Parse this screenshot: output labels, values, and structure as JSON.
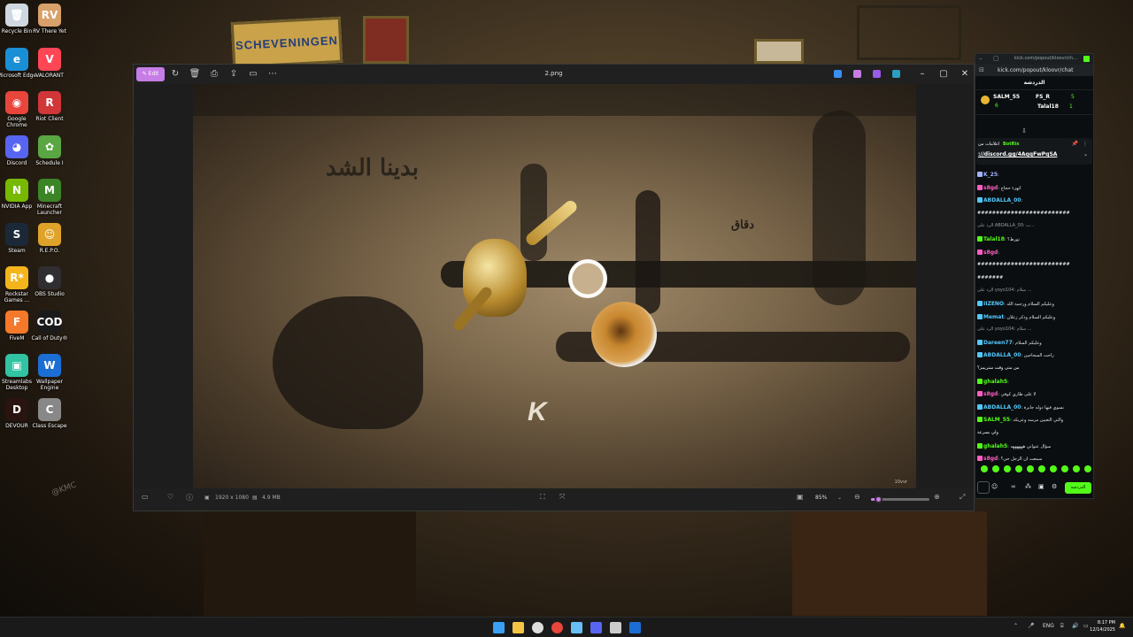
{
  "desktop": {
    "wallpaper_poster": "SCHEVENINGEN",
    "watermark": "@KMC",
    "icons": [
      {
        "label": "Recycle Bin",
        "glyph": "🗑",
        "color": "#cfd8e0"
      },
      {
        "label": "RV There Yet",
        "glyph": "RV",
        "color": "#d8a06a"
      },
      {
        "label": "Microsoft Edge",
        "glyph": "e",
        "color": "#1a8fd6"
      },
      {
        "label": "VALORANT",
        "glyph": "V",
        "color": "#ff4655"
      },
      {
        "label": "Google Chrome",
        "glyph": "◉",
        "color": "#e8453c"
      },
      {
        "label": "Riot Client",
        "glyph": "R",
        "color": "#d13639"
      },
      {
        "label": "Discord",
        "glyph": "◕",
        "color": "#5865f2"
      },
      {
        "label": "Schedule I",
        "glyph": "✿",
        "color": "#5aa642"
      },
      {
        "label": "NVIDIA App",
        "glyph": "N",
        "color": "#76b900"
      },
      {
        "label": "Minecraft Launcher",
        "glyph": "M",
        "color": "#3c8527"
      },
      {
        "label": "Steam",
        "glyph": "S",
        "color": "#1b2838"
      },
      {
        "label": "R.E.P.O.",
        "glyph": "☺",
        "color": "#e0a32a"
      },
      {
        "label": "Rockstar Games ...",
        "glyph": "R*",
        "color": "#f3b51b"
      },
      {
        "label": "OBS Studio",
        "glyph": "●",
        "color": "#302e31"
      },
      {
        "label": "FiveM",
        "glyph": "F",
        "color": "#f5792a"
      },
      {
        "label": "Call of Duty®",
        "glyph": "COD",
        "color": "#1a1a1a"
      },
      {
        "label": "Streamlabs Desktop",
        "glyph": "▣",
        "color": "#31c3a2"
      },
      {
        "label": "Wallpaper Engine",
        "glyph": "W",
        "color": "#1c6ed4"
      },
      {
        "label": "DEVOUR",
        "glyph": "D",
        "color": "#2a1410"
      },
      {
        "label": "Class Escape",
        "glyph": "C",
        "color": "#888888"
      }
    ]
  },
  "viewer": {
    "edit_label": "Edit",
    "file_name": "2.png",
    "resolution": "1920 x 1080",
    "file_size": "4.9 MB",
    "zoom_percent": "85%",
    "zoom_level": 0.12,
    "accent": "#c77de6",
    "image": {
      "title_text": "بدينا الشد",
      "subtitle_text": "دقاق",
      "logo_text": "K",
      "signature": "10vvr"
    }
  },
  "chat": {
    "url": "kick.com/popout/kloovr/ch...",
    "address": "kick.com/popout/kloovr/chat",
    "header": "الدردشة",
    "gifters": [
      {
        "name": "SALM_55",
        "count": "6"
      },
      {
        "name": "FS_R",
        "count": "5"
      },
      {
        "name": "Talal18",
        "count": "1"
      }
    ],
    "pinned": {
      "prefix": "اعلامات من",
      "user": "BotRix",
      "link": "://discord.gg/4AqqFwPqSA"
    },
    "messages": [
      {
        "user": "K_25",
        "color": "#9fb3ff",
        "text": ""
      },
      {
        "user": "s8gd",
        "color": "#ff5ec4",
        "text": "اتهزء حجاج"
      },
      {
        "user": "ABDALLA_00",
        "color": "#53c8fc",
        "text": ""
      },
      {
        "user": "",
        "color": "#ffffff",
        "text": "#########################"
      },
      {
        "user": "",
        "color": "#9a9a9a",
        "text": "الرد على ABDALLA_00: ب..."
      },
      {
        "user": "Talal18",
        "color": "#53fc18",
        "text": "تورط؟"
      },
      {
        "user": "s8gd",
        "color": "#ff5ec4",
        "text": ""
      },
      {
        "user": "",
        "color": "#ffffff",
        "text": "#########################"
      },
      {
        "user": "",
        "color": "#ffffff",
        "text": "#######"
      },
      {
        "user": "",
        "color": "#9a9a9a",
        "text": "الرد على yoyo104: سلام ..."
      },
      {
        "user": "IIZENO",
        "color": "#53c8fc",
        "text": "وعليكم السلام ورحمة الله"
      },
      {
        "user": "Memat",
        "color": "#53c8fc",
        "text": "وعليكم السلام وذكر زعلان"
      },
      {
        "user": "",
        "color": "#9a9a9a",
        "text": "الرد على yoyo104: سلام ..."
      },
      {
        "user": "Dareen77",
        "color": "#53c8fc",
        "text": "وعليكم السلام"
      },
      {
        "user": "ABDALLA_00",
        "color": "#53c8fc",
        "text": "راحت السحاجين"
      },
      {
        "user": "",
        "color": "#ffffff",
        "text": "من متى وقت ستريمز؟"
      },
      {
        "user": "ghalah5",
        "color": "#53fc18",
        "text": ""
      },
      {
        "user": "s8gd",
        "color": "#ff5ec4",
        "text": "لا على طاري كوفي"
      },
      {
        "user": "ABDALLA_00",
        "color": "#53c8fc",
        "text": "نسوي فيها دوله جابرة"
      },
      {
        "user": "SALM_55",
        "color": "#53fc18",
        "text": "والتي التعيين مرسه وعريكه"
      },
      {
        "user": "",
        "color": "#ffffff",
        "text": "ولي بسرعة"
      },
      {
        "user": "ghalah5",
        "color": "#53fc18",
        "text": "سؤال عنواني ههههههه"
      },
      {
        "user": "s8gd",
        "color": "#ff5ec4",
        "text": "سمعت ان الرجل حي؟"
      }
    ],
    "send_label": "الدردشة"
  },
  "taskbar": {
    "icons": [
      {
        "name": "start",
        "color": "#3aa0f3"
      },
      {
        "name": "file-explorer",
        "color": "#f4c542"
      },
      {
        "name": "obs",
        "color": "#dddddd"
      },
      {
        "name": "chrome",
        "color": "#e8453c"
      },
      {
        "name": "steam",
        "color": "#66c0f4"
      },
      {
        "name": "discord",
        "color": "#5865f2"
      },
      {
        "name": "chatgpt",
        "color": "#cccccc"
      },
      {
        "name": "wallpaper-engine",
        "color": "#1c6ed4"
      }
    ],
    "language": "ENG",
    "time": "8:17 PM",
    "date": "12/14/2025"
  }
}
